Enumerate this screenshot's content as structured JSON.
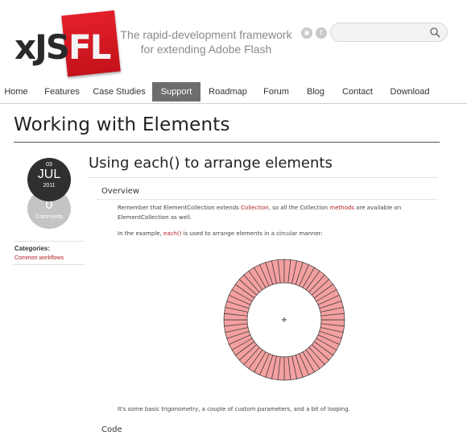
{
  "logo": {
    "part1": "xJS",
    "part2": "FL"
  },
  "tagline": {
    "line1": "The rapid-development framework",
    "line2": "for extending Adobe Flash"
  },
  "social": [
    {
      "icon": "rss-icon",
      "glyph": "◉"
    },
    {
      "icon": "twitter-icon",
      "glyph": "t"
    }
  ],
  "search": {
    "value": "",
    "placeholder": ""
  },
  "nav": {
    "items": [
      {
        "label": "Home"
      },
      {
        "label": "Features"
      },
      {
        "label": "Case Studies"
      },
      {
        "label": "Support",
        "active": true
      },
      {
        "label": "Roadmap"
      },
      {
        "label": "Forum"
      },
      {
        "label": "Blog"
      },
      {
        "label": "Contact"
      },
      {
        "label": "Download"
      }
    ]
  },
  "page_title": "Working with Elements",
  "post": {
    "day": "03",
    "month": "JUL",
    "year": "2011",
    "comments_count": "0",
    "comments_label": "Comments",
    "categories_label": "Categories:",
    "category": "Common workflows"
  },
  "article": {
    "title": "Using each() to arrange elements",
    "overview_heading": "Overview",
    "para1": {
      "t1": "Remember that ElementCollection extends ",
      "link1": "Collection",
      "t2": ", so all the Collection ",
      "link2": "methods",
      "t3": " are available on",
      "line2": "ElementCollection as well."
    },
    "para2": {
      "t1": "In the example, ",
      "link1": "each()",
      "t2": " is used to arrange elements in a circular manner:"
    },
    "figure": {
      "segments": 60,
      "fill": "#f5a0a0",
      "stroke": "#3a3a3a",
      "center_mark": "+"
    },
    "para3": "It's some basic trigonometry, a couple of custom parameters, and a bit of looping.",
    "code_heading": "Code"
  },
  "colors": {
    "accent": "#c4121b",
    "link": "#b01e22",
    "nav_active": "#6d6d6d"
  }
}
